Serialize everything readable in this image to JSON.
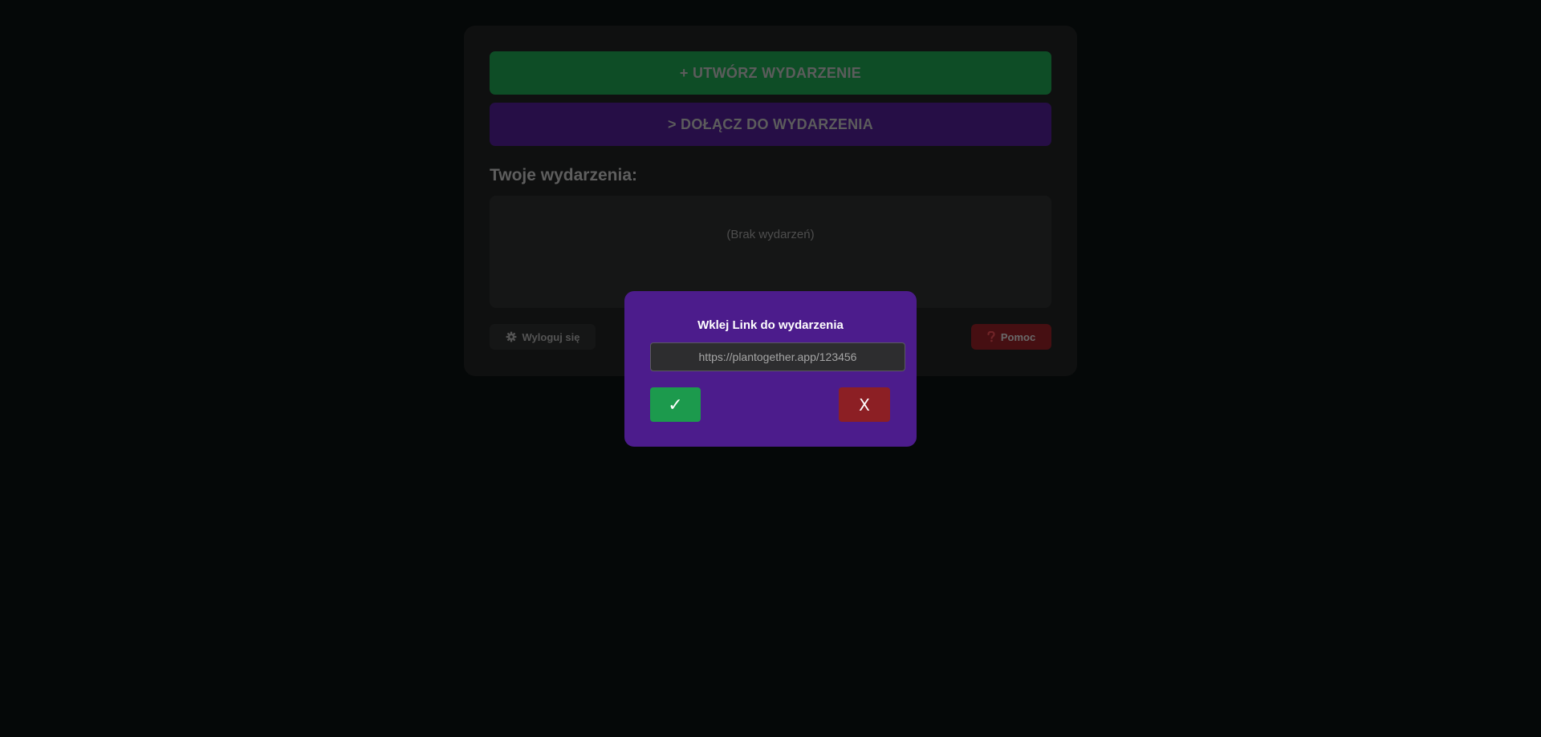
{
  "main": {
    "create_button": "+ UTWÓRZ WYDARZENIE",
    "join_button": "> DOŁĄCZ DO WYDARZENIA",
    "events_title": "Twoje wydarzenia:",
    "events_empty": "(Brak wydarzeń)",
    "logout_button": "Wyloguj się",
    "help_button": "Pomoc"
  },
  "modal": {
    "title": "Wklej Link do wydarzenia",
    "input_value": "",
    "input_placeholder": "https://plantogether.app/123456",
    "confirm_button": "✓",
    "cancel_button": "X"
  },
  "icons": {
    "logout": "gear-icon",
    "help": "question-mark-icon"
  },
  "colors": {
    "page_background": "#0b1010",
    "panel_background": "#1e2020",
    "green": "#1c9a4d",
    "purple": "#4c1c8c",
    "red": "#8c1f24"
  }
}
